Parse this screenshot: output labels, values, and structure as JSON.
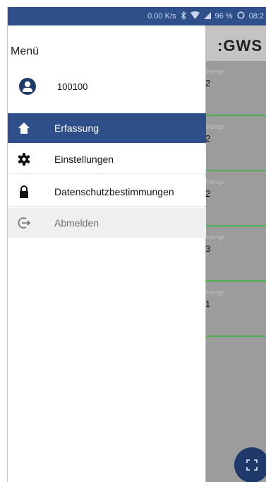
{
  "status_bar": {
    "speed": "0.00 K/s",
    "bluetooth_icon": "bluetooth-icon",
    "wifi_icon": "wifi-icon",
    "signal_icon": "signal-icon",
    "battery_percent": "96 %",
    "time": "08:2"
  },
  "background_app": {
    "logo": "GWS",
    "cards": [
      {
        "label": "Menge",
        "value": "2"
      },
      {
        "label": "Menge",
        "value": "2"
      },
      {
        "label": "Menge",
        "value": "2"
      },
      {
        "label": "Menge",
        "value": "3"
      },
      {
        "label": "Menge",
        "value": "1"
      }
    ],
    "fab_icon": "scan-icon"
  },
  "drawer": {
    "title": "Menü",
    "user": {
      "icon": "account-circle-icon",
      "name": "100100"
    },
    "items": [
      {
        "label": "Erfassung",
        "icon": "home-icon",
        "state": "active"
      },
      {
        "label": "Einstellungen",
        "icon": "gear-icon",
        "state": "normal"
      },
      {
        "label": "Datenschutzbestimmungen",
        "icon": "lock-icon",
        "state": "normal"
      },
      {
        "label": "Abmelden",
        "icon": "logout-icon",
        "state": "muted"
      }
    ],
    "colors": {
      "active_bg": "#2e4f8a",
      "muted_bg": "#efefef"
    }
  }
}
